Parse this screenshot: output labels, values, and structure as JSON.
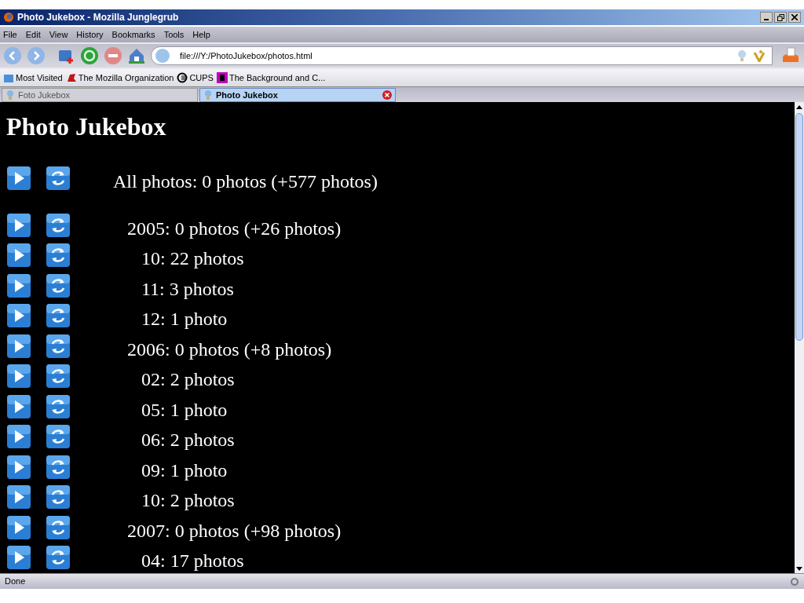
{
  "window": {
    "title": "Photo Jukebox - Mozilla Junglegrub"
  },
  "menu": [
    "File",
    "Edit",
    "View",
    "History",
    "Bookmarks",
    "Tools",
    "Help"
  ],
  "address": {
    "value": "file:///Y:/PhotoJukebox/photos.html"
  },
  "bookmarks": [
    {
      "label": "Most Visited"
    },
    {
      "label": "The Mozilla Organization"
    },
    {
      "label": "CUPS"
    },
    {
      "label": "The Background and C..."
    }
  ],
  "tabs": [
    {
      "label": "Foto Jukebox",
      "selected": false
    },
    {
      "label": "Photo Jukebox",
      "selected": true
    }
  ],
  "page": {
    "heading": "Photo Jukebox",
    "tree": [
      {
        "label": "All photos: 0 photos (+577 photos)",
        "children": [
          {
            "label": "2005: 0 photos (+26 photos)",
            "children": [
              {
                "label": "10: 22 photos"
              },
              {
                "label": "11: 3 photos"
              },
              {
                "label": "12: 1 photo"
              }
            ]
          },
          {
            "label": "2006: 0 photos (+8 photos)",
            "children": [
              {
                "label": "02: 2 photos"
              },
              {
                "label": "05: 1 photo"
              },
              {
                "label": "06: 2 photos"
              },
              {
                "label": "09: 1 photo"
              },
              {
                "label": "10: 2 photos"
              }
            ]
          },
          {
            "label": "2007: 0 photos (+98 photos)",
            "children": [
              {
                "label": "04: 17 photos"
              }
            ]
          }
        ]
      }
    ]
  },
  "status_bar": {
    "text": "Done"
  }
}
